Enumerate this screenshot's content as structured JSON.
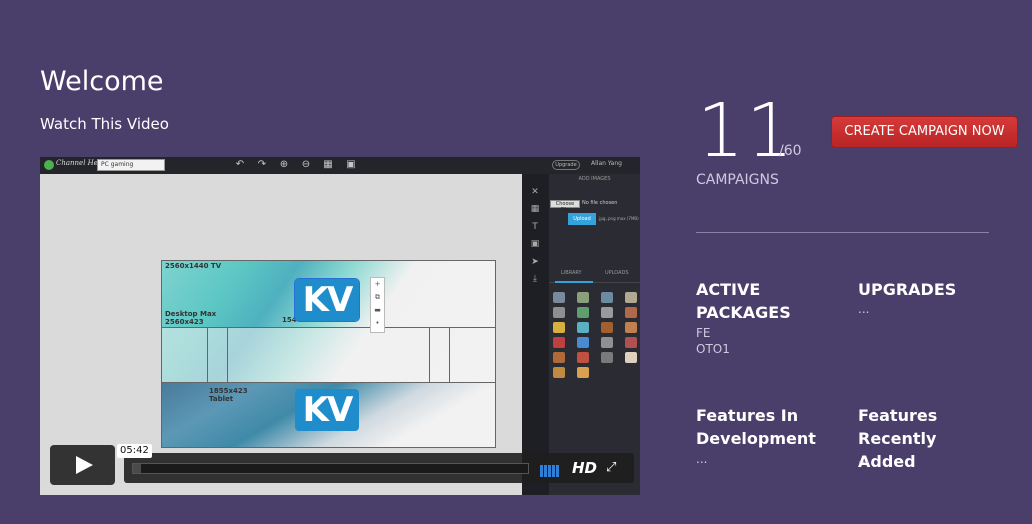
{
  "welcome": {
    "title": "Welcome",
    "subtitle": "Watch This Video"
  },
  "video": {
    "time": "05:42",
    "progress": 0.02,
    "hd_label": "HD",
    "editor": {
      "brand": "Channel Hero",
      "search_value": "PC gaming",
      "user": "Allan Yang",
      "pill": "Upgrade",
      "add_images": "ADD IMAGES",
      "choose_file": "Choose File",
      "no_file": "No file chosen",
      "upload": "Upload",
      "formats": ".jpg,.png max (7MB)",
      "tab_library": "LIBRARY",
      "tab_uploads": "UPLOADS",
      "labels": {
        "tv": "2560x1440 TV",
        "desktop": "Desktop Max\n2560x423",
        "mid": "154",
        "tablet": "1855x423\nTablet"
      },
      "logo_text": "KV"
    }
  },
  "stats": {
    "count": "11",
    "max": "/60",
    "label": "CAMPAIGNS"
  },
  "create_button": "CREATE CAMPAIGN NOW",
  "active_packages": {
    "title": "ACTIVE PACKAGES",
    "items": [
      "FE",
      "OTO1"
    ]
  },
  "upgrades": {
    "title": "UPGRADES",
    "value": "..."
  },
  "features_dev": {
    "title": "Features In Development",
    "value": "..."
  },
  "features_added": {
    "title": "Features Recently Added",
    "value": "..."
  },
  "colors": {
    "background": "#4a3f6b",
    "button": "#c62f2f",
    "accent_blue": "#1f8ccc"
  }
}
